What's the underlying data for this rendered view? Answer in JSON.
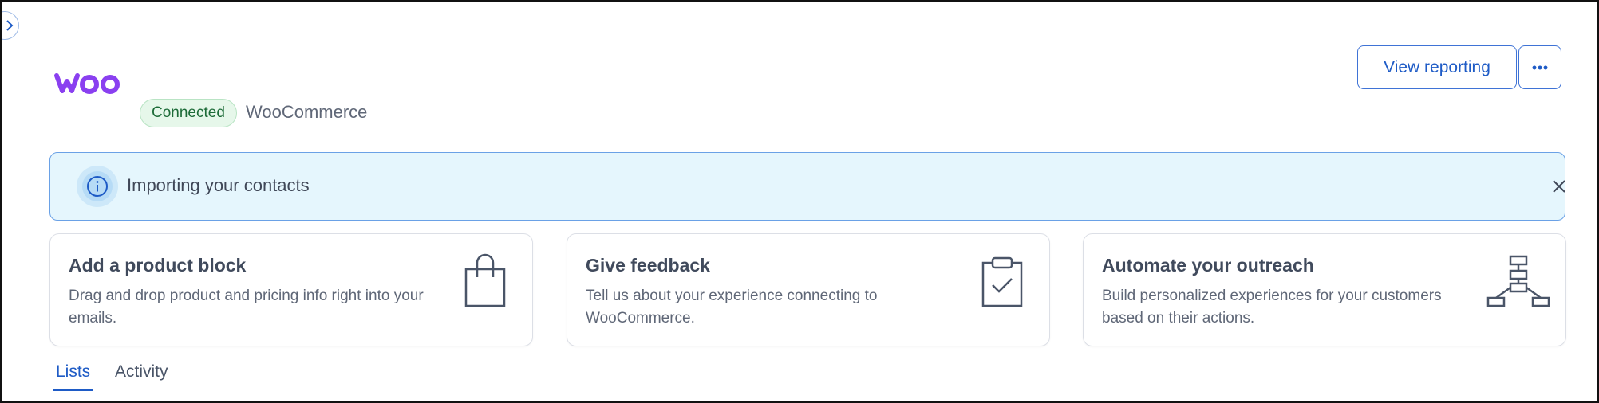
{
  "header": {
    "logo_text": "woo",
    "status_badge": "Connected",
    "app_name": "WooCommerce",
    "view_reporting_label": "View reporting",
    "more_icon": "more-horizontal-icon"
  },
  "banner": {
    "text": "Importing your contacts",
    "icon": "info-icon",
    "close_icon": "close-icon"
  },
  "cards": [
    {
      "title": "Add a product block",
      "description": "Drag and drop product and pricing info right into your emails.",
      "icon": "shopping-bag-icon"
    },
    {
      "title": "Give feedback",
      "description": "Tell us about your experience connecting to WooCommerce.",
      "icon": "clipboard-check-icon"
    },
    {
      "title": "Automate your outreach",
      "description": "Build personalized experiences for your customers based on their actions.",
      "icon": "flowchart-icon"
    }
  ],
  "tabs": [
    {
      "label": "Lists",
      "active": true
    },
    {
      "label": "Activity",
      "active": false
    }
  ],
  "colors": {
    "brand_purple": "#7f54b3",
    "accent_blue": "#1e5bc6",
    "banner_bg": "#e5f6fd",
    "connected_bg": "#e6f7ea",
    "connected_text": "#1d6b38"
  }
}
